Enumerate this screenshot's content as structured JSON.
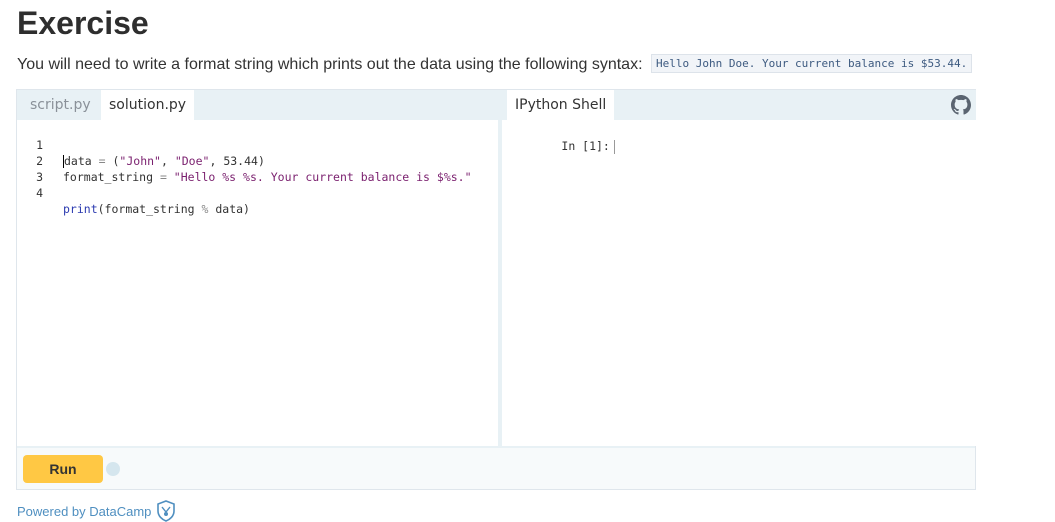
{
  "heading": "Exercise",
  "intro": {
    "text": "You will need to write a format string which prints out the data using the following syntax:",
    "code": "Hello John Doe. Your current balance is $53.44."
  },
  "editor": {
    "tabs": [
      {
        "label": "script.py",
        "active": false
      },
      {
        "label": "solution.py",
        "active": true
      }
    ],
    "line_numbers": [
      "1",
      "2",
      "3",
      "4"
    ],
    "lines": [
      [
        "data",
        " = ",
        "(",
        "\"John\"",
        ", ",
        "\"Doe\"",
        ", ",
        "53.44",
        ")"
      ],
      [
        "format_string",
        " = ",
        "\"Hello %s %s. Your current balance is $%s.\""
      ],
      [
        ""
      ],
      [
        "print",
        "(format_string ",
        "%",
        " data)"
      ]
    ]
  },
  "shell": {
    "tab_label": "IPython Shell",
    "prompt": "In [1]:"
  },
  "toolbar": {
    "run_label": "Run"
  },
  "footer": {
    "powered_by": "Powered by DataCamp"
  },
  "icons": {
    "github": "github-icon",
    "datacamp": "datacamp-shield-icon"
  },
  "colors": {
    "run_button": "#ffc844",
    "link": "#4f8fc0",
    "pane_bg": "#e8f1f5"
  }
}
